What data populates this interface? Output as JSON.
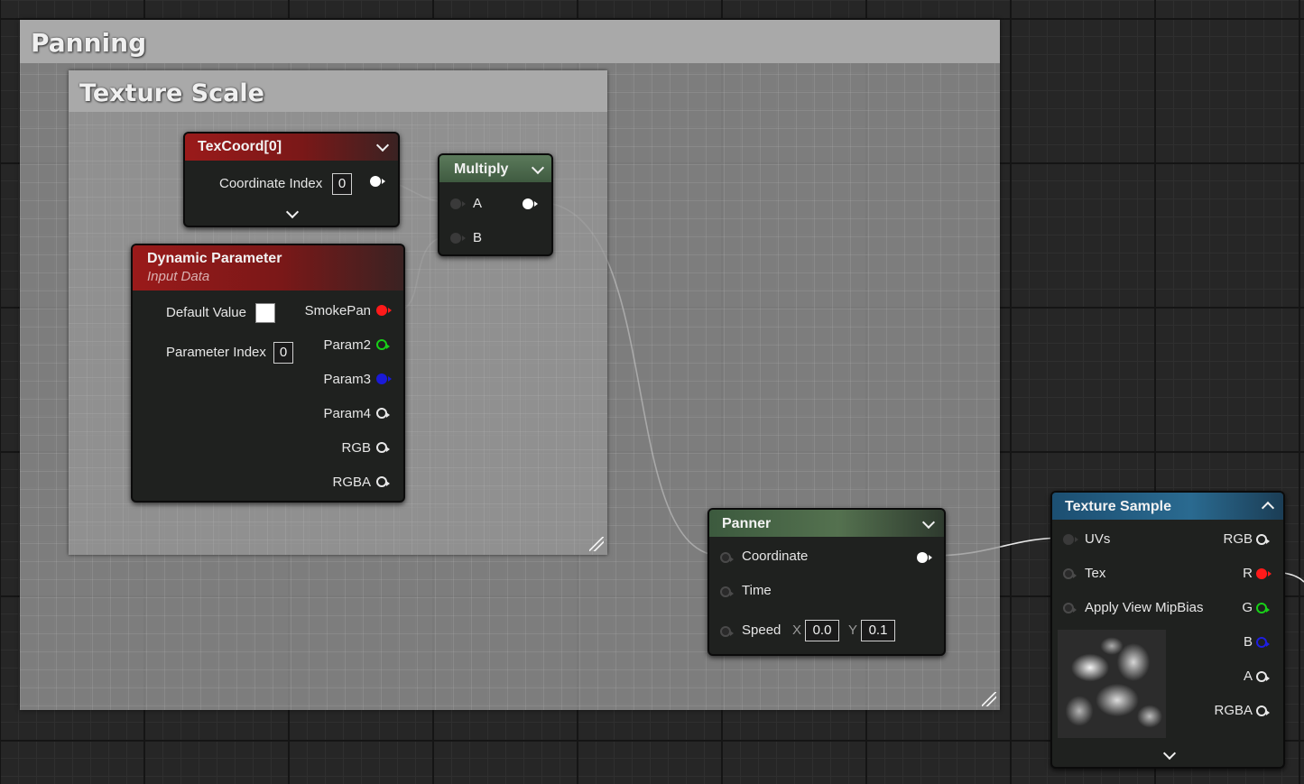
{
  "comments": {
    "outer_title": "Panning",
    "inner_title": "Texture Scale"
  },
  "texcoord": {
    "title": "TexCoord[0]",
    "coord_index_label": "Coordinate Index",
    "coord_index_value": "0"
  },
  "dynamic_param": {
    "title": "Dynamic Parameter",
    "subtitle": "Input Data",
    "default_value_label": "Default Value",
    "param_index_label": "Parameter Index",
    "param_index_value": "0",
    "outputs": [
      "SmokePan",
      "Param2",
      "Param3",
      "Param4",
      "RGB",
      "RGBA"
    ]
  },
  "multiply": {
    "title": "Multiply",
    "input_a": "A",
    "input_b": "B"
  },
  "panner": {
    "title": "Panner",
    "coordinate_label": "Coordinate",
    "time_label": "Time",
    "speed_label": "Speed",
    "speed_x_label": "X",
    "speed_x_value": "0.0",
    "speed_y_label": "Y",
    "speed_y_value": "0.1"
  },
  "texture_sample": {
    "title": "Texture Sample",
    "inputs": [
      "UVs",
      "Tex",
      "Apply View MipBias"
    ],
    "outputs": [
      "RGB",
      "R",
      "G",
      "B",
      "A",
      "RGBA"
    ]
  },
  "colors": {
    "pin_red": "#ff1a1a",
    "pin_green": "#18d018",
    "pin_blue": "#1a1ad8",
    "pin_white": "#ffffff"
  }
}
